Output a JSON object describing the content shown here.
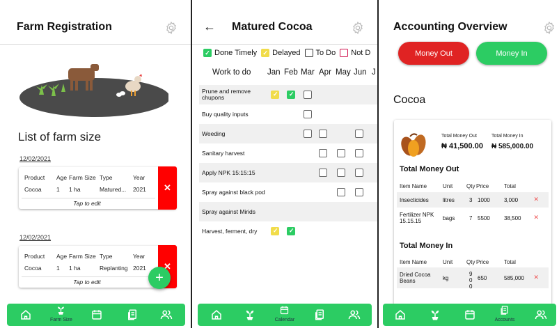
{
  "farm_registration": {
    "title": "Farm Registration",
    "list_title": "List of farm size",
    "headers": [
      "Product",
      "Age",
      "Farm Size",
      "Type",
      "Year"
    ],
    "cards": [
      {
        "date": "12/02/2021",
        "product": "Cocoa",
        "age": "1",
        "farm_size": "1 ha",
        "type": "Matured...",
        "year": "2021",
        "tap": "Tap to edit"
      },
      {
        "date": "12/02/2021",
        "product": "Cocoa",
        "age": "1",
        "farm_size": "1 ha",
        "type": "Replanting",
        "year": "2021",
        "tap": "Tap to edit"
      }
    ],
    "delete_symbol": "✕",
    "fab_symbol": "+",
    "nav_active_label": "Farm Size"
  },
  "matured_cocoa": {
    "title": "Matured Cocoa",
    "back_symbol": "←",
    "legend": [
      "Done Timely",
      "Delayed",
      "To Do",
      "Not D"
    ],
    "header_label": "Work to do",
    "months": [
      "Jan",
      "Feb",
      "Mar",
      "Apr",
      "May",
      "Jun",
      "J"
    ],
    "tasks": [
      {
        "name": "Prune and remove chupons"
      },
      {
        "name": "Buy quality inputs"
      },
      {
        "name": "Weeding"
      },
      {
        "name": "Sanitary harvest"
      },
      {
        "name": "Apply NPK 15:15:15"
      },
      {
        "name": "Spray against black pod"
      },
      {
        "name": "Spray against Mirids"
      },
      {
        "name": "Harvest, ferment, dry"
      }
    ],
    "nav_active_label": "Calendar"
  },
  "accounting": {
    "title": "Accounting Overview",
    "money_out_label": "Money Out",
    "money_in_label": "Money In",
    "crop": "Cocoa",
    "total_out_label": "Total Money Out",
    "total_in_label": "Total Money In",
    "total_out_value": "₦ 41,500.00",
    "total_in_value": "₦ 585,000.00",
    "out_title": "Total Money Out",
    "in_title": "Total Money In",
    "columns": [
      "Item Name",
      "Unit",
      "Qty",
      "Price",
      "Total"
    ],
    "out_rows": [
      {
        "item": "Insecticides",
        "unit": "litres",
        "qty": "3",
        "price": "1000",
        "total": "3,000"
      },
      {
        "item": "Fertilizer NPK 15.15.15",
        "unit": "bags",
        "qty": "7",
        "price": "5500",
        "total": "38,500"
      }
    ],
    "in_rows": [
      {
        "item": "Dried Cocoa Beans",
        "unit": "kg",
        "qty": "90 0",
        "price": "650",
        "total": "585,000"
      }
    ],
    "delete_symbol": "✕",
    "nav_active_label": "Accounts",
    "colors": {
      "money_out": "#e02323",
      "money_in": "#2ccc63"
    }
  },
  "colors": {
    "green": "#2ccc63",
    "yellow": "#f1dc4a",
    "red": "#ff0000",
    "not_done": "#d0104c"
  }
}
